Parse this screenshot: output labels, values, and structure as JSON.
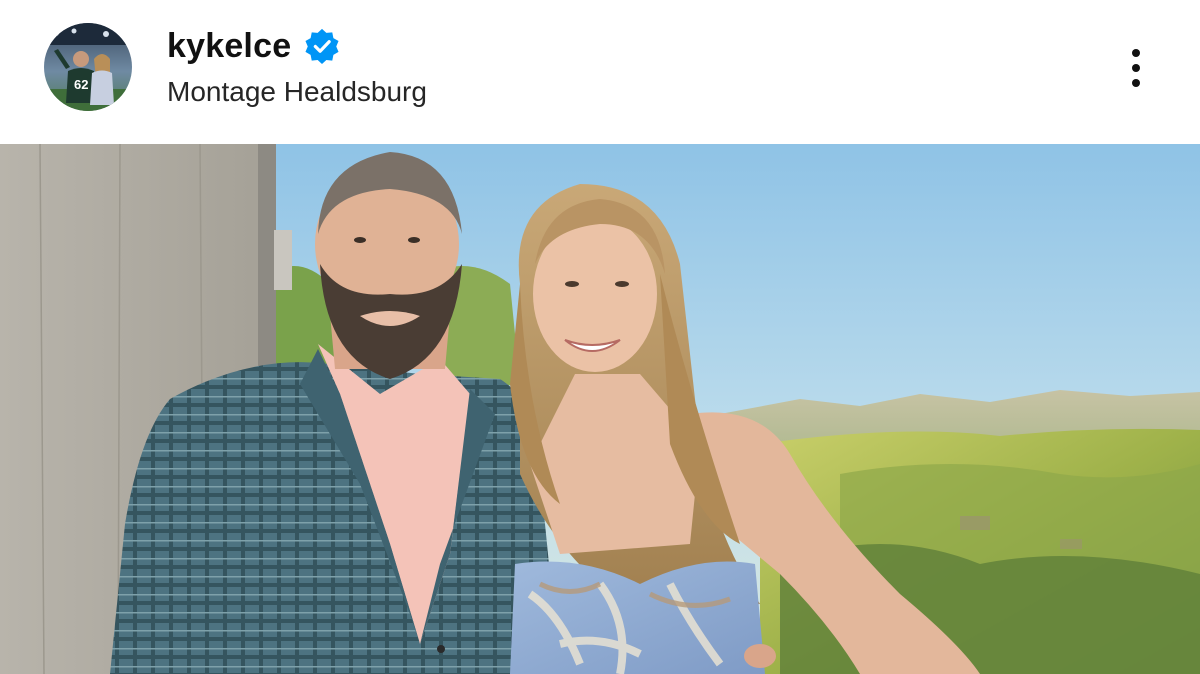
{
  "post_header": {
    "username": "kykelce",
    "location": "Montage Healdsburg",
    "avatar_icon": "profile-avatar-icon",
    "verified_icon": "verified-badge-icon",
    "more_icon": "more-options-icon",
    "verified_color": "#0095f6"
  },
  "photo": {
    "subject_icon": "post-photo"
  }
}
